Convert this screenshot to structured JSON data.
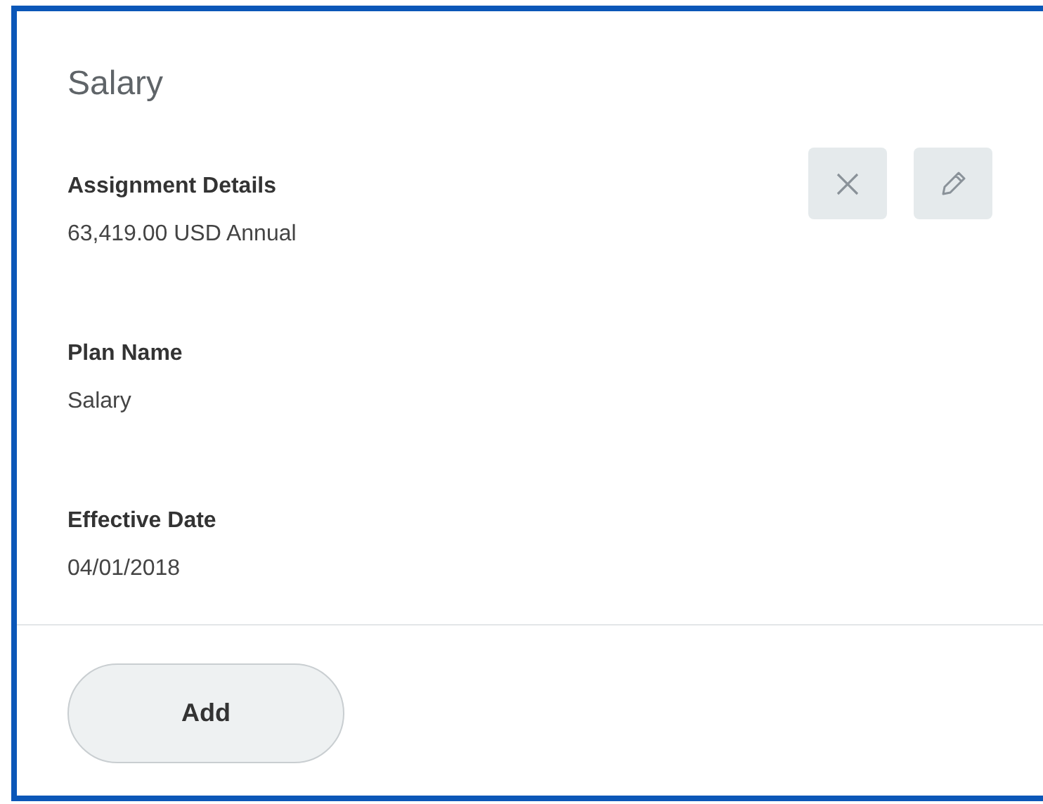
{
  "card": {
    "title": "Salary",
    "actions": [
      {
        "kind": "remove"
      },
      {
        "kind": "edit"
      }
    ],
    "fields": [
      {
        "label": "Assignment Details",
        "value": "63,419.00 USD Annual"
      },
      {
        "label": "Plan Name",
        "value": "Salary"
      },
      {
        "label": "Effective Date",
        "value": "04/01/2018"
      }
    ],
    "button": "Add"
  }
}
